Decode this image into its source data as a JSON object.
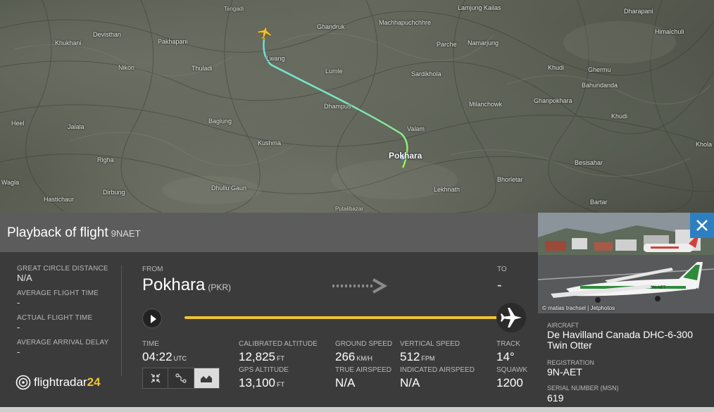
{
  "map": {
    "places": [
      {
        "name": "Tangadi",
        "cls": "small"
      },
      {
        "name": "Ghandruk",
        "cls": ""
      },
      {
        "name": "Machhapuchchhre",
        "cls": ""
      },
      {
        "name": "Lamjung Kailas",
        "cls": ""
      },
      {
        "name": "Dharapani",
        "cls": ""
      },
      {
        "name": "Himalchuli",
        "cls": ""
      },
      {
        "name": "Devisthan",
        "cls": ""
      },
      {
        "name": "Khukhani",
        "cls": ""
      },
      {
        "name": "Pakhapani",
        "cls": ""
      },
      {
        "name": "Lwang",
        "cls": ""
      },
      {
        "name": "Namarjung",
        "cls": ""
      },
      {
        "name": "Parche",
        "cls": ""
      },
      {
        "name": "Nikori",
        "cls": ""
      },
      {
        "name": "Thuladi",
        "cls": ""
      },
      {
        "name": "Lumle",
        "cls": ""
      },
      {
        "name": "Sardikhola",
        "cls": ""
      },
      {
        "name": "Khudi",
        "cls": ""
      },
      {
        "name": "Ghermu",
        "cls": ""
      },
      {
        "name": "Bahundanda",
        "cls": ""
      },
      {
        "name": "Dhampus",
        "cls": ""
      },
      {
        "name": "Milanchowk",
        "cls": ""
      },
      {
        "name": "Ghanpokhara",
        "cls": ""
      },
      {
        "name": "Baglung",
        "cls": ""
      },
      {
        "name": "Pokhara",
        "cls": "big"
      },
      {
        "name": "Valam",
        "cls": ""
      },
      {
        "name": "Jalala",
        "cls": ""
      },
      {
        "name": "Kushma",
        "cls": ""
      },
      {
        "name": "Besisahar",
        "cls": ""
      },
      {
        "name": "Righa",
        "cls": ""
      },
      {
        "name": "Bhorletar",
        "cls": ""
      },
      {
        "name": "Lekhnath",
        "cls": ""
      },
      {
        "name": "Dirbung",
        "cls": ""
      },
      {
        "name": "Hastichaur",
        "cls": ""
      },
      {
        "name": "Wagla",
        "cls": ""
      },
      {
        "name": "Bartar",
        "cls": ""
      },
      {
        "name": "Putalibazar",
        "cls": "small"
      },
      {
        "name": "Heel",
        "cls": ""
      },
      {
        "name": "Dhullu Gaun",
        "cls": ""
      },
      {
        "name": "Khudi",
        "cls": ""
      },
      {
        "name": "Khola",
        "cls": ""
      }
    ],
    "path_color_start": "#9af54a",
    "path_color_end": "#6fe0e6",
    "plane_color": "#f1c232"
  },
  "header": {
    "title": "Playback of flight",
    "registration": "9NAET"
  },
  "stats": [
    {
      "label": "GREAT CIRCLE DISTANCE",
      "value": "N/A"
    },
    {
      "label": "AVERAGE FLIGHT TIME",
      "value": "-"
    },
    {
      "label": "ACTUAL FLIGHT TIME",
      "value": "-"
    },
    {
      "label": "AVERAGE ARRIVAL DELAY",
      "value": "-"
    }
  ],
  "route": {
    "from_label": "FROM",
    "from_city": "Pokhara",
    "from_code": "(PKR)",
    "to_label": "TO",
    "to_city": "-"
  },
  "metrics": {
    "time_label": "TIME",
    "time_value": "04:22",
    "time_unit": "UTC",
    "cal_alt_label": "CALIBRATED ALTITUDE",
    "cal_alt_value": "12,825",
    "cal_alt_unit": "FT",
    "gps_alt_label": "GPS ALTITUDE",
    "gps_alt_value": "13,100",
    "gps_alt_unit": "FT",
    "ground_speed_label": "GROUND SPEED",
    "ground_speed_value": "266",
    "ground_speed_unit": "KM/H",
    "true_airspeed_label": "TRUE AIRSPEED",
    "true_airspeed_value": "N/A",
    "vertical_speed_label": "VERTICAL SPEED",
    "vertical_speed_value": "512",
    "vertical_speed_unit": "FPM",
    "indicated_airspeed_label": "INDICATED AIRSPEED",
    "indicated_airspeed_value": "N/A",
    "track_label": "TRACK",
    "track_value": "14°",
    "squawk_label": "SQUAWK",
    "squawk_value": "1200"
  },
  "brand": {
    "name_part1": "flightradar",
    "name_part2": "24"
  },
  "aircraft": {
    "photo_credit": "© matias trachsel | Jetphotos",
    "aircraft_label": "AIRCRAFT",
    "aircraft_value": "De Havilland Canada DHC-6-300 Twin Otter",
    "registration_label": "REGISTRATION",
    "registration_value": "9N-AET",
    "serial_label": "SERIAL NUMBER (MSN)",
    "serial_value": "619"
  },
  "colors": {
    "accent_yellow": "#f1c232",
    "close_blue": "#2d7fc1",
    "header_grey": "#5c5c5c",
    "panel_dark": "#3b3b3b"
  },
  "icons": [
    "play-icon",
    "airplane-icon",
    "close-icon",
    "collapse-icon",
    "route-icon",
    "altitude-chart-icon",
    "arrow-right-icon",
    "fr24-radar-icon"
  ]
}
